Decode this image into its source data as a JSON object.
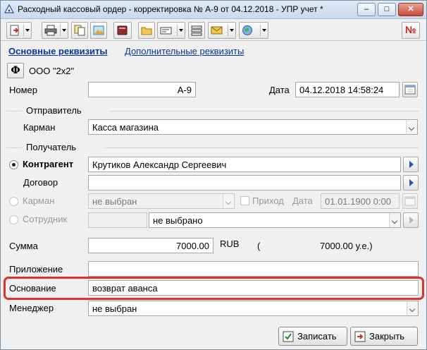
{
  "window": {
    "title": "Расходный кассовый ордер - корректировка № А-9 от 04.12.2018 - УПР учет *",
    "minimize": "–",
    "maximize": "□",
    "close": "✕"
  },
  "toolbar": {
    "buttons": [
      "save-icon",
      "print-icon",
      "copy-icon",
      "image-icon",
      "book-icon",
      "folder-icon",
      "card-icon",
      "list-icon",
      "envelope-icon",
      "globe-icon",
      "number-icon"
    ],
    "number_label": "№"
  },
  "tabs": {
    "main": "Основные реквизиты",
    "additional": "Дополнительные реквизиты"
  },
  "org": {
    "phi_label": "Ф",
    "name": "ООО \"2x2\""
  },
  "number": {
    "label": "Номер",
    "value": "А-9"
  },
  "date": {
    "label": "Дата",
    "value": "04.12.2018 14:58:24"
  },
  "sender": {
    "group_label": "Отправитель",
    "pocket_label": "Карман",
    "pocket_value": "Касса магазина"
  },
  "receiver": {
    "group_label": "Получатель",
    "counterparty_label": "Контрагент",
    "counterparty_value": "Крутиков Александр Сергеевич",
    "contract_label": "Договор",
    "contract_value": "",
    "pocket_label": "Карман",
    "pocket_value": "не выбран",
    "income_label": "Приход",
    "date_label": "Дата",
    "date_value": "01.01.1900 0:00",
    "employee_label": "Сотрудник",
    "employee_code": "",
    "employee_value": "не выбрано"
  },
  "amount": {
    "label": "Сумма",
    "value": "7000.00",
    "currency": "RUB",
    "paren": "(",
    "ue_value": "7000.00 у.е.)"
  },
  "attachment": {
    "label": "Приложение",
    "value": ""
  },
  "basis": {
    "label": "Основание",
    "value": "возврат аванса"
  },
  "manager": {
    "label": "Менеджер",
    "value": "не выбран"
  },
  "actions": {
    "save": "Записать",
    "close": "Закрыть"
  },
  "colors": {
    "highlight": "#e0322a",
    "link": "#0a34a0"
  }
}
